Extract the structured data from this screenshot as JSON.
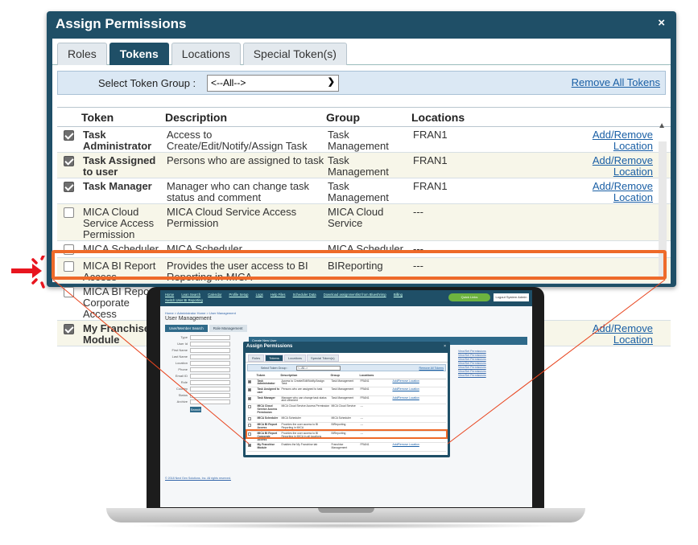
{
  "dialog": {
    "title": "Assign Permissions",
    "close_glyph": "×",
    "tabs": [
      {
        "label": "Roles",
        "active": false
      },
      {
        "label": "Tokens",
        "active": true
      },
      {
        "label": "Locations",
        "active": false
      },
      {
        "label": "Special Token(s)",
        "active": false
      }
    ],
    "token_group": {
      "label": "Select Token Group :",
      "value": "<--All-->"
    },
    "remove_all_label": "Remove All Tokens",
    "columns": {
      "token": "Token",
      "description": "Description",
      "group": "Group",
      "locations": "Locations"
    },
    "rows": [
      {
        "checked": true,
        "token": "Task Administrator",
        "description": "Access to Create/Edit/Notify/Assign Task",
        "group": "Task Management",
        "locations": "FRAN1",
        "action": "Add/Remove Location",
        "bold": true
      },
      {
        "checked": true,
        "token": "Task Assigned to user",
        "description": "Persons who are assigned to task",
        "group": "Task Management",
        "locations": "FRAN1",
        "action": "Add/Remove Location",
        "bold": true
      },
      {
        "checked": true,
        "token": "Task Manager",
        "description": "Manager who can change task status and comment",
        "group": "Task Management",
        "locations": "FRAN1",
        "action": "Add/Remove Location",
        "bold": true
      },
      {
        "checked": false,
        "token": "MICA Cloud Service Access Permission",
        "description": "MICA Cloud Service Access Permission",
        "group": "MICA Cloud Service",
        "locations": "---",
        "action": "",
        "bold": false
      },
      {
        "checked": false,
        "token": "MICA Scheduler",
        "description": "MICA Scheduler",
        "group": "MICA Scheduler",
        "locations": "---",
        "action": "",
        "bold": false
      },
      {
        "checked": false,
        "token": "MICA BI Report Access",
        "description": "Provides the user access to BI Reporting in MICA",
        "group": "BIReporting",
        "locations": "---",
        "action": "",
        "bold": false
      },
      {
        "checked": false,
        "token": "MICA BI Report Corporate Access",
        "description": "Provides the user access to BI Reporting in MICA in all locations",
        "group": "BIReporting",
        "locations": "---",
        "action": "",
        "bold": false
      },
      {
        "checked": true,
        "token": "My Franchise Module",
        "description": "Enables the My Franchise tab",
        "group": "Franchise Management",
        "locations": "FRAN1",
        "action": "Add/Remove Location",
        "bold": true
      }
    ]
  },
  "screen": {
    "nav": [
      "Home",
      "Lean Search",
      "Calendar",
      "Profile Setup",
      "Logs",
      "Help Files",
      "Scheduler Data",
      "Download assignmentlist from Blueshrimp",
      "Billing"
    ],
    "nav_sub": "Switch User  BI Reporting",
    "quick_button": "Quick Links",
    "logout": "Logout System Admin",
    "breadcrumb": "Home > Administrator Home > User Management",
    "title": "User Management",
    "tabs": [
      "User/Member Search",
      "Role Management"
    ],
    "form_labels": [
      "Type",
      "User Id",
      "First Name",
      "Last Name",
      "Location",
      "Phone",
      "Email ID",
      "Role",
      "Country",
      "Status",
      "Archive"
    ],
    "search_button": "Search",
    "grid_header": "Create New User",
    "links": [
      "View/Set Permissions",
      "View/Set Permissions",
      "View/Set Permissions",
      "View/Set Permissions",
      "View/Set Permissions",
      "View/Set Permissions",
      "View/Set Permissions"
    ],
    "copyright": "© 2018 Next Gen Solutions, Inc. All rights reserved."
  },
  "colors": {
    "accent": "#1f4f67",
    "highlight": "#ee6a2a",
    "link": "#1a5fa5",
    "zoom_line": "#e8451f",
    "red_mark": "#e8151f"
  }
}
